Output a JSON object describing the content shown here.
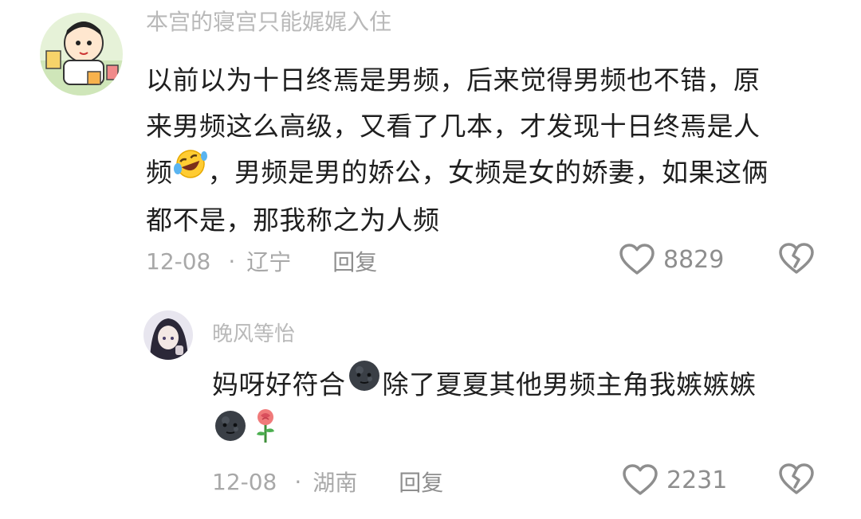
{
  "comment": {
    "username": "本宫的寝宫只能娓娓入住",
    "lines": [
      "以前以为十日终焉是男频，后来觉得男频也不错，原",
      "来男频这么高级，又看了几本，才发现十日终焉是人",
      [
        "频",
        "，男频是男的娇公，女频是女的娇妻，如果这俩"
      ],
      "都不是，那我称之为人频"
    ],
    "emoji_line3": "rolling-laughing-emoji",
    "date": "12-08",
    "separator": "·",
    "location": "辽宁",
    "reply_label": "回复",
    "like_count": "8829"
  },
  "reply": {
    "username": "晚风等怡",
    "line1_text": "妈呀好符合",
    "line1_rest": "除了夏夏其他男频主角我嫉嫉嫉",
    "line2_emojis": [
      "dark-moon-face-emoji",
      "rose-emoji"
    ],
    "date": "12-08",
    "separator": "·",
    "location": "湖南",
    "reply_label": "回复",
    "like_count": "2231"
  },
  "colors": {
    "text": "#1f1f1f",
    "meta": "#a8a8a8",
    "icon": "#8e8e8e"
  }
}
